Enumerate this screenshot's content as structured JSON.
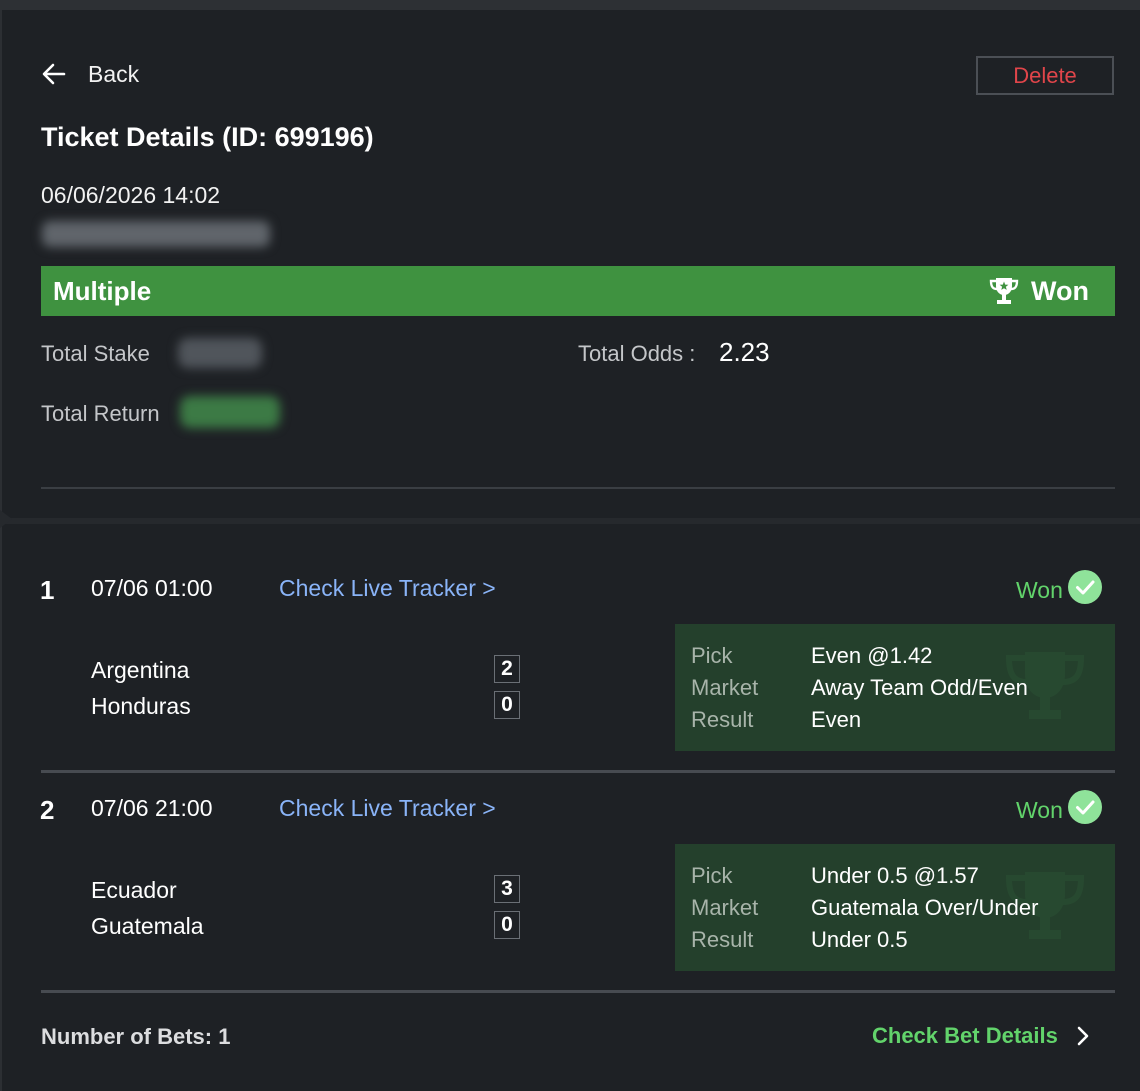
{
  "header": {
    "back_label": "Back",
    "delete_label": "Delete",
    "title": "Ticket Details (ID: 699196)",
    "datetime": "06/06/2026 14:02"
  },
  "summary": {
    "bet_type": "Multiple",
    "status": "Won",
    "total_stake_label": "Total Stake",
    "total_odds_label": "Total Odds :",
    "total_odds_value": "2.23",
    "total_return_label": "Total Return"
  },
  "legs": [
    {
      "number": "1",
      "time": "07/06 01:00",
      "tracker_label": "Check Live Tracker >",
      "status": "Won",
      "home_team": "Argentina",
      "away_team": "Honduras",
      "home_score": "2",
      "away_score": "0",
      "pick_label": "Pick",
      "pick_value": "Even @1.42",
      "market_label": "Market",
      "market_value": "Away Team Odd/Even",
      "result_label": "Result",
      "result_value": "Even"
    },
    {
      "number": "2",
      "time": "07/06 21:00",
      "tracker_label": "Check Live Tracker >",
      "status": "Won",
      "home_team": "Ecuador",
      "away_team": "Guatemala",
      "home_score": "3",
      "away_score": "0",
      "pick_label": "Pick",
      "pick_value": "Under 0.5 @1.57",
      "market_label": "Market",
      "market_value": "Guatemala Over/Under",
      "result_label": "Result",
      "result_value": "Under 0.5"
    }
  ],
  "footer": {
    "number_of_bets": "Number of Bets: 1",
    "check_details_label": "Check Bet Details"
  },
  "colors": {
    "background": "#1e2125",
    "won_banner": "#3f9240",
    "won_text": "#62d36b",
    "link": "#8ab4f8",
    "delete": "#e0454a",
    "pick_box": "#24402c"
  },
  "icons": {
    "back": "arrow-left-icon",
    "banner_status": "trophy-icon",
    "leg_status": "check-circle-icon",
    "footer_link": "chevron-right-icon"
  }
}
